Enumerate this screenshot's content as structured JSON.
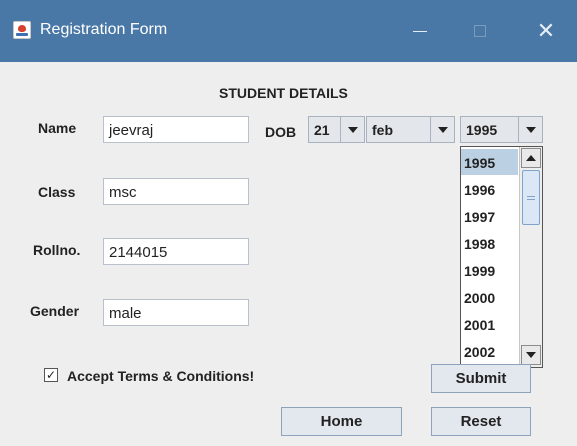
{
  "window": {
    "title": "Registration Form",
    "icon": "java-app-icon",
    "minimize_glyph": "—",
    "close_glyph": "✕"
  },
  "form": {
    "heading": "STUDENT DETAILS",
    "name_label": "Name",
    "name_value": "jeevraj",
    "class_label": "Class",
    "class_value": "msc",
    "rollno_label": "Rollno.",
    "rollno_value": "2144015",
    "gender_label": "Gender",
    "gender_value": "male",
    "dob_label": "DOB",
    "dob_day": "21",
    "dob_month": "feb",
    "dob_year": "1995",
    "year_options": [
      "1995",
      "1996",
      "1997",
      "1998",
      "1999",
      "2000",
      "2001",
      "2002"
    ],
    "year_selected_index": 0,
    "terms_label": "Accept Terms & Conditions!",
    "terms_checked": true,
    "terms_check_glyph": "✓",
    "submit_label": "Submit",
    "home_label": "Home",
    "reset_label": "Reset"
  },
  "colors": {
    "titlebar": "#4a78a6",
    "selection": "#bcd0e4",
    "background": "#eeeeee"
  }
}
